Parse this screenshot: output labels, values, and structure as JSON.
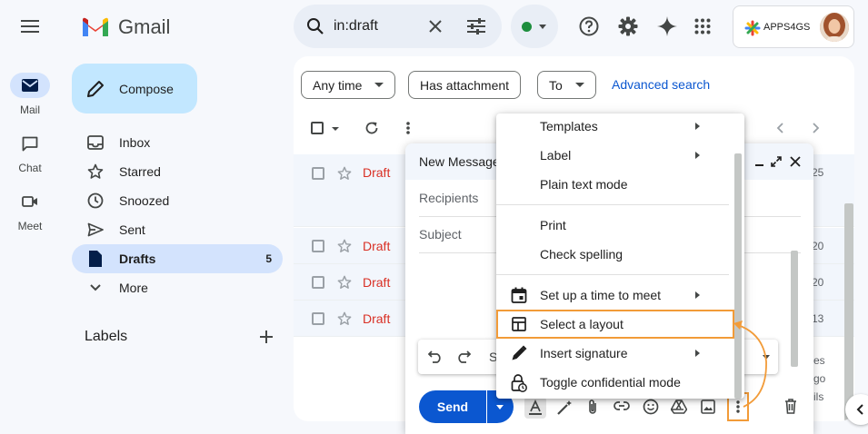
{
  "brand": {
    "name": "Gmail",
    "account_label": "APPS4GS"
  },
  "search": {
    "query": "in:draft"
  },
  "rail": [
    {
      "label": "Mail",
      "icon": "mail-icon"
    },
    {
      "label": "Chat",
      "icon": "chat-icon"
    },
    {
      "label": "Meet",
      "icon": "video-icon"
    }
  ],
  "sidebar": {
    "compose_label": "Compose",
    "items": [
      {
        "label": "Inbox",
        "icon": "inbox-icon"
      },
      {
        "label": "Starred",
        "icon": "star-icon"
      },
      {
        "label": "Snoozed",
        "icon": "clock-icon"
      },
      {
        "label": "Sent",
        "icon": "send-icon"
      },
      {
        "label": "Drafts",
        "icon": "draft-icon",
        "count": "5"
      },
      {
        "label": "More",
        "icon": "chevron-down-icon"
      }
    ],
    "labels_heading": "Labels"
  },
  "filters": {
    "any_time": "Any time",
    "has_attachment": "Has attachment",
    "to": "To",
    "advanced": "Advanced search"
  },
  "rows": [
    {
      "label": "Draft",
      "date": "25"
    },
    {
      "label": "Draft",
      "date": "20"
    },
    {
      "label": "Draft",
      "date": "20"
    },
    {
      "label": "Draft",
      "date": "13"
    }
  ],
  "compose": {
    "title": "New Message",
    "recipients_placeholder": "Recipients",
    "subject_placeholder": "Subject",
    "send_label": "Send",
    "format_letter": "S"
  },
  "menu": {
    "items": [
      {
        "label": "Templates",
        "submenu": true
      },
      {
        "label": "Label",
        "submenu": true
      },
      {
        "label": "Plain text mode"
      },
      {
        "label": "Print"
      },
      {
        "label": "Check spelling"
      },
      {
        "label": "Set up a time to meet",
        "submenu": true,
        "icon": "calendar-icon"
      },
      {
        "label": "Select a layout",
        "icon": "layout-icon",
        "highlighted": true
      },
      {
        "label": "Insert signature",
        "submenu": true,
        "icon": "pen-icon"
      },
      {
        "label": "Toggle confidential mode",
        "icon": "lock-clock-icon"
      }
    ]
  },
  "edge_text": [
    "es",
    "go",
    "ils"
  ],
  "colors": {
    "accent": "#0b57d0",
    "highlight": "#f29b38",
    "compose_bg": "#c2e7ff",
    "nav_active": "#d3e3fd",
    "draft_red": "#d93025"
  }
}
